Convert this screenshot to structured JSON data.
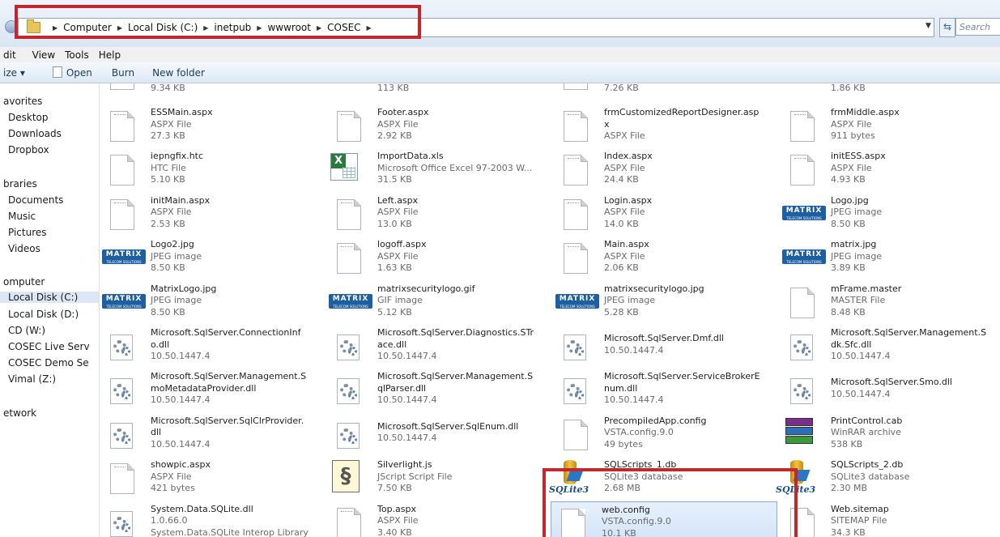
{
  "address_bar": {
    "crumbs": [
      "Computer",
      "Local Disk (C:)",
      "inetpub",
      "wwwroot",
      "COSEC"
    ],
    "search_placeholder": "Search"
  },
  "menu": [
    "dit",
    "View",
    "Tools",
    "Help"
  ],
  "toolbar": {
    "organize": "ize ▾",
    "open": "Open",
    "burn": "Burn",
    "new_folder": "New folder"
  },
  "nav": {
    "favorites": "avorites",
    "desktop": "Desktop",
    "downloads": "Downloads",
    "dropbox": "Dropbox",
    "libraries": "braries",
    "documents": "Documents",
    "music": "Music",
    "pictures": "Pictures",
    "videos": "Videos",
    "computer": "omputer",
    "local_c": "Local Disk (C:)",
    "local_d": "Local Disk (D:)",
    "cd": "CD (W:)",
    "cosec_live": "COSEC Live Serv",
    "cosec_demo": "COSEC Demo Se",
    "vimal": "Vimal (Z:)",
    "network": "etwork"
  },
  "files": [
    {
      "n": "",
      "t": "",
      "s": "9.34 KB",
      "icon": "aspx"
    },
    {
      "n": "",
      "t": "",
      "s": "113 KB",
      "icon": "pdf"
    },
    {
      "n": "",
      "t": "",
      "s": "7.26 KB",
      "icon": "aspx"
    },
    {
      "n": "",
      "t": "",
      "s": "1.86 KB",
      "icon": "red"
    },
    {
      "n": "ESSMain.aspx",
      "t": "ASPX File",
      "s": "27.3 KB",
      "icon": "aspx"
    },
    {
      "n": "Footer.aspx",
      "t": "ASPX File",
      "s": "2.92 KB",
      "icon": "aspx"
    },
    {
      "n": "frmCustomizedReportDesigner.asp",
      "t": "x",
      "s": "ASPX File",
      "icon": "aspx"
    },
    {
      "n": "frmMiddle.aspx",
      "t": "ASPX File",
      "s": "911 bytes",
      "icon": "aspx"
    },
    {
      "n": "iepngfix.htc",
      "t": "HTC File",
      "s": "5.10 KB",
      "icon": "blank"
    },
    {
      "n": "ImportData.xls",
      "t": "Microsoft Office Excel 97-2003 W...",
      "s": "31.5 KB",
      "icon": "xls"
    },
    {
      "n": "Index.aspx",
      "t": "ASPX File",
      "s": "24.4 KB",
      "icon": "aspx"
    },
    {
      "n": "initESS.aspx",
      "t": "ASPX File",
      "s": "4.93 KB",
      "icon": "aspx"
    },
    {
      "n": "initMain.aspx",
      "t": "ASPX File",
      "s": "2.53 KB",
      "icon": "aspx"
    },
    {
      "n": "Left.aspx",
      "t": "ASPX File",
      "s": "13.0 KB",
      "icon": "aspx"
    },
    {
      "n": "Login.aspx",
      "t": "ASPX File",
      "s": "14.0 KB",
      "icon": "aspx"
    },
    {
      "n": "Logo.jpg",
      "t": "JPEG image",
      "s": "8.50 KB",
      "icon": "matrix"
    },
    {
      "n": "Logo2.jpg",
      "t": "JPEG image",
      "s": "8.50 KB",
      "icon": "matrix"
    },
    {
      "n": "logoff.aspx",
      "t": "ASPX File",
      "s": "1.63 KB",
      "icon": "aspx"
    },
    {
      "n": "Main.aspx",
      "t": "ASPX File",
      "s": "2.06 KB",
      "icon": "aspx"
    },
    {
      "n": "matrix.jpg",
      "t": "JPEG image",
      "s": "3.89 KB",
      "icon": "matrix"
    },
    {
      "n": "MatrixLogo.jpg",
      "t": "JPEG image",
      "s": "8.50 KB",
      "icon": "matrix"
    },
    {
      "n": "matrixsecuritylogo.gif",
      "t": "GIF image",
      "s": "5.12 KB",
      "icon": "matrix"
    },
    {
      "n": "matrixsecuritylogo.jpg",
      "t": "JPEG image",
      "s": "5.28 KB",
      "icon": "matrix"
    },
    {
      "n": "mFrame.master",
      "t": "MASTER File",
      "s": "8.48 KB",
      "icon": "blank"
    },
    {
      "n": "Microsoft.SqlServer.ConnectionInf",
      "t": "o.dll",
      "s": "10.50.1447.4",
      "icon": "dll"
    },
    {
      "n": "Microsoft.SqlServer.Diagnostics.STr",
      "t": "ace.dll",
      "s": "10.50.1447.4",
      "icon": "dll"
    },
    {
      "n": "",
      "t": "Microsoft.SqlServer.Dmf.dll",
      "s": "10.50.1447.4",
      "icon": "dll",
      "single": true
    },
    {
      "n": "Microsoft.SqlServer.Management.S",
      "t": "dk.Sfc.dll",
      "s": "10.50.1447.4",
      "icon": "dll"
    },
    {
      "n": "Microsoft.SqlServer.Management.S",
      "t": "moMetadataProvider.dll",
      "s": "10.50.1447.4",
      "icon": "dll"
    },
    {
      "n": "Microsoft.SqlServer.Management.S",
      "t": "qlParser.dll",
      "s": "10.50.1447.4",
      "icon": "dll"
    },
    {
      "n": "Microsoft.SqlServer.ServiceBrokerE",
      "t": "num.dll",
      "s": "10.50.1447.4",
      "icon": "dll"
    },
    {
      "n": "",
      "t": "Microsoft.SqlServer.Smo.dll",
      "s": "10.50.1447.4",
      "icon": "dll",
      "single": true
    },
    {
      "n": "Microsoft.SqlServer.SqlClrProvider.",
      "t": "dll",
      "s": "10.50.1447.4",
      "icon": "dll"
    },
    {
      "n": "",
      "t": "Microsoft.SqlServer.SqlEnum.dll",
      "s": "10.50.1447.4",
      "icon": "dll",
      "single": true
    },
    {
      "n": "PrecompiledApp.config",
      "t": "VSTA.config.9.0",
      "s": "49 bytes",
      "icon": "blank"
    },
    {
      "n": "PrintControl.cab",
      "t": "WinRAR archive",
      "s": "538 KB",
      "icon": "rar"
    },
    {
      "n": "showpic.aspx",
      "t": "ASPX File",
      "s": "421 bytes",
      "icon": "aspx"
    },
    {
      "n": "Silverlight.js",
      "t": "JScript Script File",
      "s": "7.50 KB",
      "icon": "js"
    },
    {
      "n": "SQLScripts_1.db",
      "t": "SQLite3 database",
      "s": "2.68 MB",
      "icon": "sqlite"
    },
    {
      "n": "SQLScripts_2.db",
      "t": "SQLite3 database",
      "s": "2.30 MB",
      "icon": "sqlite"
    },
    {
      "n": "System.Data.SQLite.dll",
      "t": "1.0.66.0",
      "s": "System.Data.SQLite Interop Library",
      "icon": "dll"
    },
    {
      "n": "Top.aspx",
      "t": "ASPX File",
      "s": "3.40 KB",
      "icon": "aspx"
    },
    {
      "n": "web.config",
      "t": "VSTA.config.9.0",
      "s": "10.1 KB",
      "icon": "blank",
      "selected": true
    },
    {
      "n": "Web.sitemap",
      "t": "SITEMAP File",
      "s": "34.3 KB",
      "icon": "blank"
    }
  ],
  "sqlite_label": "SQLite3",
  "matrix_label": "MATRIX",
  "matrix_sub": "TELECOM SOLUTIONS",
  "colors": {
    "highlight_red": "#c1272d",
    "selection": "#d3e4f8"
  }
}
